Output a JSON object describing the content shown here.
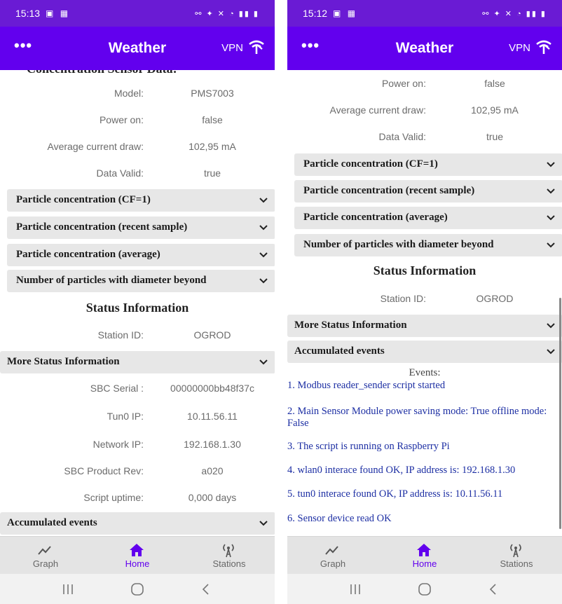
{
  "left": {
    "status_time": "15:13",
    "app_title": "Weather",
    "menu_label": "•••",
    "vpn_label": "VPN",
    "cut_heading": "Concentration Sensor Data:",
    "sensor_rows": [
      {
        "key": "Model:",
        "value": "PMS7003"
      },
      {
        "key": "Power on:",
        "value": "false"
      },
      {
        "key": "Average current draw:",
        "value": "102,95 mA"
      },
      {
        "key": "Data Valid:",
        "value": "true"
      }
    ],
    "accordions": [
      "Particle concentration (CF=1)",
      "Particle concentration (recent sample)",
      "Particle concentration (average)",
      "Number of particles with diameter beyond"
    ],
    "status_title": "Status Information",
    "station_row": {
      "key": "Station ID:",
      "value": "OGROD"
    },
    "more_status": "More Status Information",
    "more_rows": [
      {
        "key": "SBC Serial :",
        "value": "00000000bb48f37c"
      },
      {
        "key": "Tun0 IP:",
        "value": "10.11.56.11"
      },
      {
        "key": "Network IP:",
        "value": "192.168.1.30"
      },
      {
        "key": "SBC Product Rev:",
        "value": "a020"
      },
      {
        "key": "Script uptime:",
        "value": "0,000 days"
      }
    ],
    "accumulated": "Accumulated events"
  },
  "right": {
    "status_time": "15:12",
    "app_title": "Weather",
    "menu_label": "•••",
    "vpn_label": "VPN",
    "sensor_rows": [
      {
        "key": "Power on:",
        "value": "false"
      },
      {
        "key": "Average current draw:",
        "value": "102,95 mA"
      },
      {
        "key": "Data Valid:",
        "value": "true"
      }
    ],
    "accordions": [
      "Particle concentration (CF=1)",
      "Particle concentration (recent sample)",
      "Particle concentration (average)",
      "Number of particles with diameter beyond"
    ],
    "status_title": "Status Information",
    "station_row": {
      "key": "Station ID:",
      "value": "OGROD"
    },
    "more_status": "More Status Information",
    "accumulated": "Accumulated events",
    "events_title": "Events:",
    "events": [
      "1. Modbus reader_sender script started",
      "2. Main Sensor Module power saving mode: True offline mode: False",
      "3. The script is running on Raspberry Pi",
      "4. wlan0 interace found OK, IP address is: 192.168.1.30",
      "5. tun0 interace found OK, IP address is: 10.11.56.11",
      "6. Sensor device read OK"
    ]
  },
  "nav": {
    "graph": "Graph",
    "home": "Home",
    "stations": "Stations"
  },
  "colors": {
    "status_bar": "#6a1bd4",
    "app_bar": "#6200ee",
    "active_nav": "#6200ee",
    "event_text": "#1c2ea3",
    "accordion_bg": "#e7e7e7"
  },
  "icons": {
    "menu": "more-horizontal-icon",
    "wifi": "wifi-signal-icon",
    "graph": "trending-line-icon",
    "home": "home-icon",
    "stations": "antenna-icon",
    "chevron": "chevron-down-icon",
    "sys_recents": "recents-icon",
    "sys_home": "home-circle-icon",
    "sys_back": "back-icon"
  }
}
